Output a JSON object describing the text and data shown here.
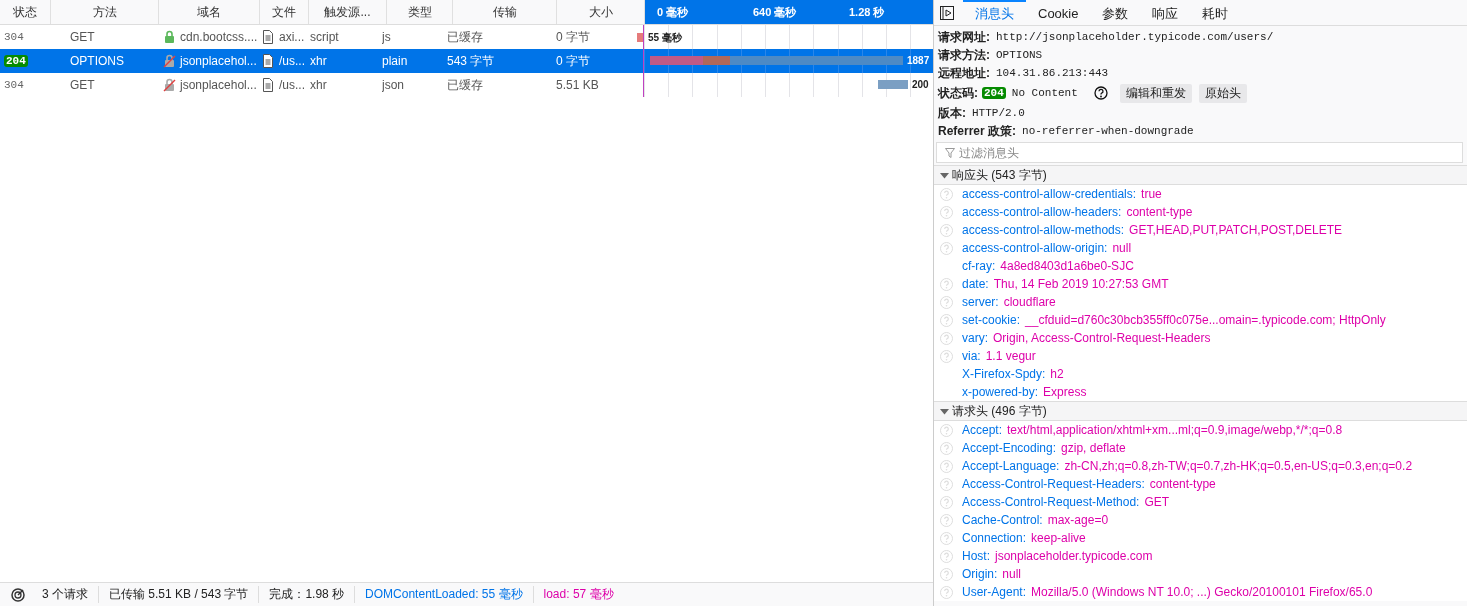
{
  "table": {
    "columns": [
      "状态",
      "方法",
      "域名",
      "文件",
      "触发源...",
      "类型",
      "传输",
      "大小"
    ],
    "timeline": [
      "0 毫秒",
      "640 毫秒",
      "1.28 秒"
    ],
    "rows": [
      {
        "status": "304",
        "cached": true,
        "method": "GET",
        "secure": true,
        "domain": "cdn.bootcss....",
        "file": "axi...",
        "cause": "script",
        "type": "js",
        "transferred": "已缓存",
        "size": "0 字节",
        "kind": "blip",
        "timing": "55 毫秒",
        "selected": false
      },
      {
        "status": "204",
        "cached": false,
        "method": "OPTIONS",
        "secure": false,
        "domain": "jsonplacehol...",
        "file": "/us...",
        "cause": "xhr",
        "type": "plain",
        "transferred": "543 字节",
        "size": "0 字节",
        "kind": "full",
        "timing": "1887",
        "selected": true
      },
      {
        "status": "304",
        "cached": true,
        "method": "GET",
        "secure": false,
        "domain": "jsonplacehol...",
        "file": "/us...",
        "cause": "xhr",
        "type": "json",
        "transferred": "已缓存",
        "size": "5.51 KB",
        "kind": "late",
        "timing": "200",
        "selected": false
      }
    ]
  },
  "status_bar": [
    {
      "kind": "plain",
      "text": "3 个请求"
    },
    {
      "kind": "plain",
      "text": "已传输 5.51 KB / 543 字节"
    },
    {
      "kind": "plain",
      "text": "完成：1.98 秒"
    },
    {
      "kind": "dom",
      "text": "DOMContentLoaded: 55 毫秒"
    },
    {
      "kind": "load",
      "text": "load: 57 毫秒"
    }
  ],
  "details": {
    "tabs": [
      {
        "label": "消息头",
        "selected": true
      },
      {
        "label": "Cookie",
        "selected": false
      },
      {
        "label": "参数",
        "selected": false
      },
      {
        "label": "响应",
        "selected": false
      },
      {
        "label": "耗时",
        "selected": false
      }
    ],
    "summary": [
      {
        "label": "请求网址:",
        "value": "http://jsonplaceholder.typicode.com/users/"
      },
      {
        "label": "请求方法:",
        "value": "OPTIONS"
      },
      {
        "label": "远程地址:",
        "value": "104.31.86.213:443"
      }
    ],
    "status": {
      "label": "状态码:",
      "code": "204",
      "text": "No Content",
      "buttons": [
        "编辑和重发",
        "原始头"
      ]
    },
    "summary_after": [
      {
        "label": "版本:",
        "value": "HTTP/2.0"
      },
      {
        "label": "Referrer 政策:",
        "value": "no-referrer-when-downgrade"
      }
    ],
    "filter": {
      "placeholder": "过滤消息头"
    },
    "sections": [
      {
        "title": "响应头 (543 字节)",
        "expanded": true,
        "headers": [
          {
            "name": "access-control-allow-credentials:",
            "value": "true",
            "help": true
          },
          {
            "name": "access-control-allow-headers:",
            "value": "content-type",
            "help": true
          },
          {
            "name": "access-control-allow-methods:",
            "value": "GET,HEAD,PUT,PATCH,POST,DELETE",
            "help": true
          },
          {
            "name": "access-control-allow-origin:",
            "value": "null",
            "help": true
          },
          {
            "name": "cf-ray:",
            "value": "4a8ed8403d1a6be0-SJC",
            "help": false
          },
          {
            "name": "date:",
            "value": "Thu, 14 Feb 2019 10:27:53 GMT",
            "help": true
          },
          {
            "name": "server:",
            "value": "cloudflare",
            "help": true
          },
          {
            "name": "set-cookie:",
            "value": "__cfduid=d760c30bcb355ff0c075e...omain=.typicode.com; HttpOnly",
            "help": true
          },
          {
            "name": "vary:",
            "value": "Origin, Access-Control-Request-Headers",
            "help": true
          },
          {
            "name": "via:",
            "value": "1.1 vegur",
            "help": true
          },
          {
            "name": "X-Firefox-Spdy:",
            "value": "h2",
            "help": false
          },
          {
            "name": "x-powered-by:",
            "value": "Express",
            "help": false
          }
        ]
      },
      {
        "title": "请求头 (496 字节)",
        "expanded": true,
        "headers": [
          {
            "name": "Accept:",
            "value": "text/html,application/xhtml+xm...ml;q=0.9,image/webp,*/*;q=0.8",
            "help": true
          },
          {
            "name": "Accept-Encoding:",
            "value": "gzip, deflate",
            "help": true
          },
          {
            "name": "Accept-Language:",
            "value": "zh-CN,zh;q=0.8,zh-TW;q=0.7,zh-HK;q=0.5,en-US;q=0.3,en;q=0.2",
            "help": true
          },
          {
            "name": "Access-Control-Request-Headers:",
            "value": "content-type",
            "help": true
          },
          {
            "name": "Access-Control-Request-Method:",
            "value": "GET",
            "help": true
          },
          {
            "name": "Cache-Control:",
            "value": "max-age=0",
            "help": true
          },
          {
            "name": "Connection:",
            "value": "keep-alive",
            "help": true
          },
          {
            "name": "Host:",
            "value": "jsonplaceholder.typicode.com",
            "help": true
          },
          {
            "name": "Origin:",
            "value": "null",
            "help": true
          },
          {
            "name": "User-Agent:",
            "value": "Mozilla/5.0 (Windows NT 10.0; ...) Gecko/20100101 Firefox/65.0",
            "help": true
          }
        ]
      }
    ]
  }
}
